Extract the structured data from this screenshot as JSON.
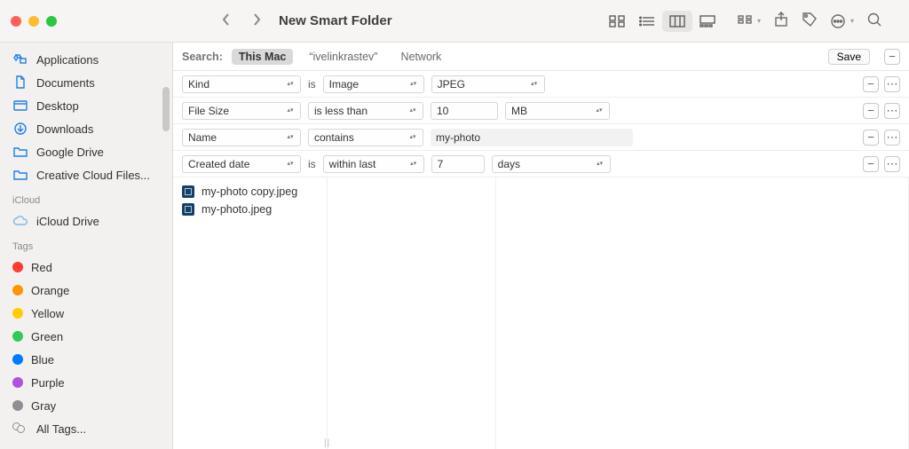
{
  "window": {
    "title": "New Smart Folder"
  },
  "sidebar": {
    "favorites": [
      {
        "label": "Applications"
      },
      {
        "label": "Documents"
      },
      {
        "label": "Desktop"
      },
      {
        "label": "Downloads"
      },
      {
        "label": "Google Drive"
      },
      {
        "label": "Creative Cloud Files..."
      }
    ],
    "icloud_header": "iCloud",
    "icloud_item": "iCloud Drive",
    "tags_header": "Tags",
    "tags": [
      {
        "label": "Red",
        "color": "#ff3b30"
      },
      {
        "label": "Orange",
        "color": "#ff9500"
      },
      {
        "label": "Yellow",
        "color": "#ffcc00"
      },
      {
        "label": "Green",
        "color": "#34c759"
      },
      {
        "label": "Blue",
        "color": "#007aff"
      },
      {
        "label": "Purple",
        "color": "#af52de"
      },
      {
        "label": "Gray",
        "color": "#8e8e93"
      }
    ],
    "all_tags": "All Tags..."
  },
  "scope": {
    "label": "Search:",
    "options": [
      "This Mac",
      "“ivelinkrastev”",
      "Network"
    ],
    "save": "Save"
  },
  "criteria": [
    {
      "attr": "Kind",
      "join": "is",
      "val1": "Image",
      "val2": "JPEG"
    },
    {
      "attr": "File Size",
      "join_select": "is less than",
      "num": "10",
      "unit": "MB"
    },
    {
      "attr": "Name",
      "join_select": "contains",
      "text": "my-photo"
    },
    {
      "attr": "Created date",
      "join": "is",
      "val1": "within last",
      "num": "7",
      "unit": "days"
    }
  ],
  "results": [
    {
      "name": "my-photo copy.jpeg"
    },
    {
      "name": "my-photo.jpeg"
    }
  ]
}
